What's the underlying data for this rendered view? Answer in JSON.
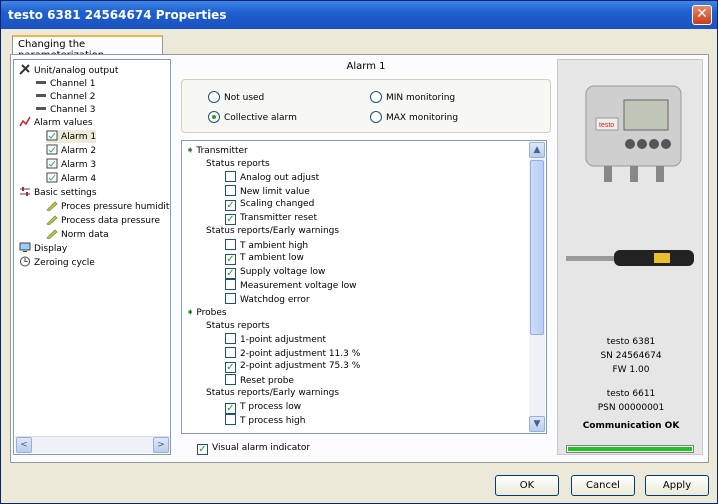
{
  "window": {
    "title": "testo 6381  24564674 Properties"
  },
  "tab": {
    "label": "Changing the parameterization"
  },
  "tree": [
    {
      "label": "Unit/analog output"
    },
    {
      "label": "Channel 1"
    },
    {
      "label": "Channel 2"
    },
    {
      "label": "Channel 3"
    },
    {
      "label": "Alarm values"
    },
    {
      "label": "Alarm 1"
    },
    {
      "label": "Alarm 2"
    },
    {
      "label": "Alarm 3"
    },
    {
      "label": "Alarm 4"
    },
    {
      "label": "Basic settings"
    },
    {
      "label": "Proces pressure humidity"
    },
    {
      "label": "Process data pressure"
    },
    {
      "label": "Norm data"
    },
    {
      "label": "Display"
    },
    {
      "label": "Zeroing cycle"
    }
  ],
  "alarm": {
    "title": "Alarm 1",
    "options": {
      "not_used": "Not used",
      "collective": "Collective alarm",
      "min": "MIN monitoring",
      "max": "MAX monitoring"
    },
    "selected": "Collective alarm"
  },
  "list": [
    {
      "label": "Transmitter",
      "type": "group"
    },
    {
      "label": "Status reports",
      "type": "sub"
    },
    {
      "label": "Analog out adjust",
      "type": "item",
      "checked": false
    },
    {
      "label": "New limit value",
      "type": "item",
      "checked": false
    },
    {
      "label": "Scaling changed",
      "type": "item",
      "checked": true
    },
    {
      "label": "Transmitter reset",
      "type": "item",
      "checked": true
    },
    {
      "label": "Status reports/Early warnings",
      "type": "sub"
    },
    {
      "label": "T ambient high",
      "type": "item",
      "checked": false
    },
    {
      "label": "T ambient low",
      "type": "item",
      "checked": true
    },
    {
      "label": "Supply voltage low",
      "type": "item",
      "checked": true
    },
    {
      "label": "Measurement voltage low",
      "type": "item",
      "checked": false
    },
    {
      "label": "Watchdog error",
      "type": "item",
      "checked": false
    },
    {
      "label": "Probes",
      "type": "group"
    },
    {
      "label": "Status reports",
      "type": "sub"
    },
    {
      "label": "1-point adjustment",
      "type": "item",
      "checked": false
    },
    {
      "label": "2-point adjustment 11.3 %",
      "type": "item",
      "checked": false
    },
    {
      "label": "2-point adjustment 75.3 %",
      "type": "item",
      "checked": true
    },
    {
      "label": "Reset probe",
      "type": "item",
      "checked": false
    },
    {
      "label": "Status reports/Early warnings",
      "type": "sub"
    },
    {
      "label": "T process low",
      "type": "item",
      "checked": true
    },
    {
      "label": "T process high",
      "type": "item",
      "checked": false
    }
  ],
  "visual_indicator": {
    "label": "Visual alarm indicator",
    "checked": true
  },
  "device": {
    "model": "testo 6381",
    "sn": "SN 24564674",
    "fw": "FW  1.00",
    "probe_model": "testo 6611",
    "psn": "PSN 00000001",
    "status": "Communication OK",
    "progress": 1.0,
    "progress_color": "#1cc51c"
  },
  "buttons": {
    "ok": "OK",
    "cancel": "Cancel",
    "apply": "Apply"
  },
  "colors": {
    "title_bar": "#1f5fd0",
    "panel": "#ece9d8"
  }
}
